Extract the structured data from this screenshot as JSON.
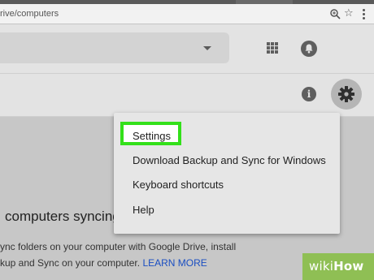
{
  "browser": {
    "url": "rive/computers"
  },
  "header": {
    "apps_icon": "apps-grid-icon",
    "notifications_icon": "bell-icon"
  },
  "toolbar": {
    "info_icon_glyph": "i",
    "settings_icon": "gear-icon"
  },
  "settings_menu": {
    "items": [
      {
        "label": "Settings",
        "highlighted": true
      },
      {
        "label": "Download Backup and Sync for Windows"
      },
      {
        "label": "Keyboard shortcuts"
      },
      {
        "label": "Help"
      }
    ],
    "highlight_color": "#33e01a"
  },
  "main": {
    "title": "computers syncing",
    "desc_line1": "ync folders on your computer with Google Drive, install",
    "desc_line2_prefix": "kup and Sync on your computer.",
    "learn_more": "LEARN MORE"
  },
  "watermark": {
    "prefix": "wiki",
    "suffix": "How"
  }
}
